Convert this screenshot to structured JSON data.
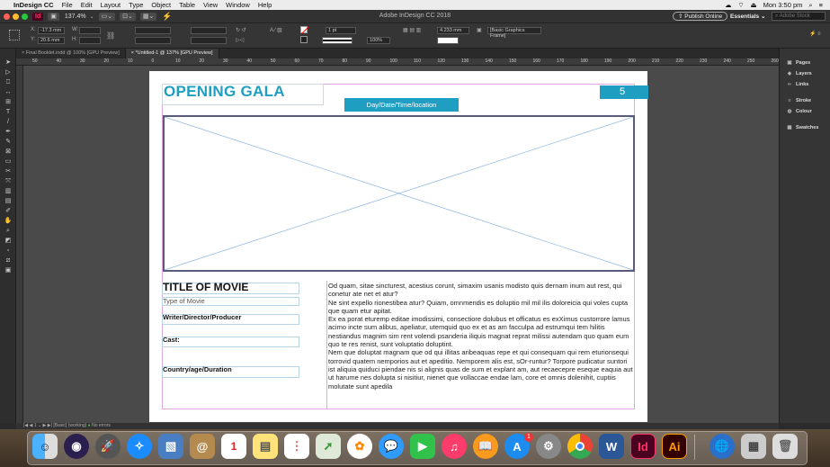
{
  "menubar": {
    "apple_glyph": "",
    "app_name": "InDesign CC",
    "items": [
      "File",
      "Edit",
      "Layout",
      "Type",
      "Object",
      "Table",
      "View",
      "Window",
      "Help"
    ],
    "clock": "Mon 3:50 pm"
  },
  "appbar": {
    "logo": "Id",
    "zoom": "137.4%",
    "title": "Adobe InDesign CC 2018",
    "publish_label": "Publish Online",
    "workspace": "Essentials",
    "search_placeholder": "Adobe Stock"
  },
  "control": {
    "x_label": "X:",
    "x_value": "-17.3 mm",
    "y_label": "Y:",
    "y_value": "20.6 mm",
    "w_label": "W:",
    "h_label": "H:",
    "stroke_weight": "1 pt",
    "opacity": "100%",
    "size_value": "4.233 mm",
    "object_style": "[Basic Graphics Frame]"
  },
  "tabs": [
    {
      "label": "Final Booklet.indd @ 100% [GPU Preview]"
    },
    {
      "label": "*Untitled-1 @ 137% [GPU Preview]"
    }
  ],
  "ruler_marks": [
    "50",
    "40",
    "30",
    "20",
    "10",
    "0",
    "10",
    "20",
    "30",
    "40",
    "50",
    "60",
    "70",
    "80",
    "90",
    "100",
    "110",
    "120",
    "130",
    "140",
    "150",
    "160",
    "170",
    "180",
    "190",
    "200",
    "210",
    "220",
    "230",
    "240",
    "250",
    "260"
  ],
  "document": {
    "heading": "OPENING GALA",
    "page_number": "5",
    "banner": "Day/Date/Time/location",
    "movie_title": "TITLE OF MOVIE",
    "movie_type": "Type of Movie",
    "writer_label": "Writer/Director/Producer",
    "cast_label": "Cast:",
    "country_label": "Country/age/Duration",
    "body_text": "Od quam, sitae sincturest, acestius corunt, simaxim usanis modisto quis dernam inum aut rest, qui conetur ate net et atur?\nNe sint expello rionestibea atur? Quiam, omnmendis es doluptio mil mil ilis doloreicia qui voles cupta que quam etur apitat.\nEx ea porat eturemp editae imodissimi, consectiore dolubus et officatus es exXimus custorrore lamus acimo incte sum alibus, apeliatur, utemquid quo ex et as am facculpa ad estrumqui tem hilitis nestiandus magnim sim rent volendi psanderia iliquis magnat reprat milissi autendam quo quam eum quo te res renist, sunt voluptatio doluptint.\nNem que doluptat magnam que od qui illitas aribeaquas repe et qui consequam qui rem eturionsequi torrovid quatem nemporios aut et apeditio. Nemporem alis est, sOr-runtur? Torpore pudicatur suntori ist aliquia quiduci piendae nis si alignis quas de sum et explant am, aut recaecepre eseque eaquia aut ut harume nes dolupta si nisitiur, nienet que vollaccae endae lam, core et omnis dolenihit, cuptiis molutate sunt apedila"
  },
  "panels": [
    {
      "label": "Pages",
      "icon": "pages-icon"
    },
    {
      "label": "Layers",
      "icon": "layers-icon"
    },
    {
      "label": "Links",
      "icon": "links-icon"
    },
    {
      "label": "Stroke",
      "icon": "stroke-icon"
    },
    {
      "label": "Colour",
      "icon": "colour-icon"
    },
    {
      "label": "Swatches",
      "icon": "swatches-icon"
    }
  ],
  "status": {
    "page": "1",
    "style": "[Basic] (working)",
    "errors": "No errors"
  },
  "dock": {
    "calendar_day": "1",
    "appstore_badge": "1",
    "indesign": "Id",
    "illustrator": "Ai",
    "word": "W"
  },
  "colors": {
    "accent_cyan": "#1e9fc2",
    "indesign_pink": "#ff3366",
    "illustrator_orange": "#ff9a00"
  }
}
